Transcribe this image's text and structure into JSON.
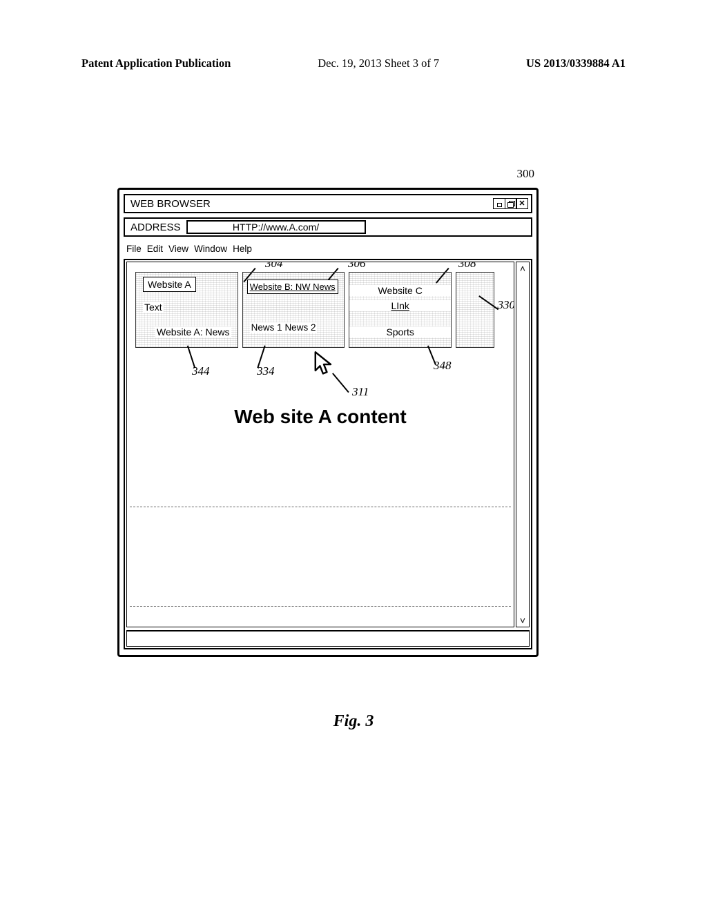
{
  "page_header": {
    "left": "Patent Application Publication",
    "mid": "Dec. 19, 2013  Sheet 3 of 7",
    "right": "US 2013/0339884 A1"
  },
  "figure_ref_main": "300",
  "window": {
    "title": "WEB BROWSER",
    "address_label": "ADDRESS",
    "address_value": "HTTP://www.A.com/"
  },
  "menubar": [
    "File",
    "Edit",
    "View",
    "Window",
    "Help"
  ],
  "tabs": {
    "a": {
      "box": "Website A",
      "text_label": "Text",
      "news_label": "Website A: News"
    },
    "b": {
      "box": "Website B: NW News",
      "news_label": "News 1 News 2"
    },
    "c": {
      "title": "Website C",
      "link_label": "LInk",
      "sports_label": "Sports"
    }
  },
  "refs": {
    "r304": "304",
    "r306": "306",
    "r308": "308",
    "r330": "330",
    "r344": "344",
    "r334": "334",
    "r311": "311",
    "r348": "348"
  },
  "content_heading": "Web site A content",
  "figure_caption": "Fig. 3"
}
